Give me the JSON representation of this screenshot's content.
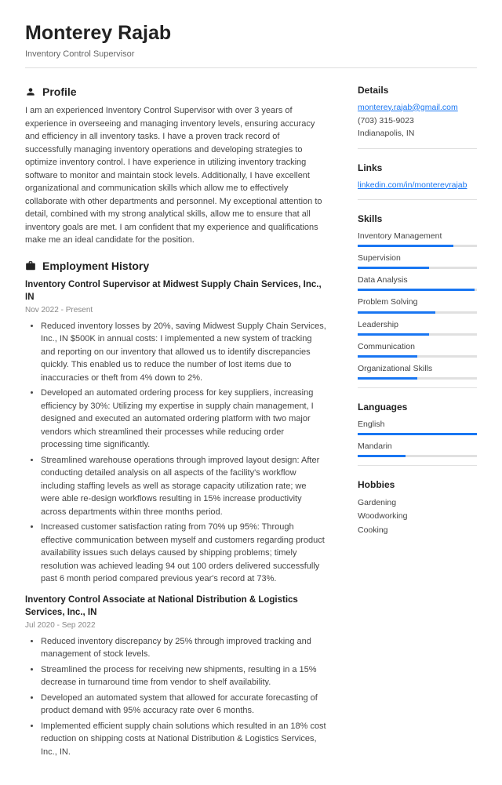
{
  "header": {
    "name": "Monterey Rajab",
    "title": "Inventory Control Supervisor"
  },
  "profile": {
    "heading": "Profile",
    "text": "I am an experienced Inventory Control Supervisor with over 3 years of experience in overseeing and managing inventory levels, ensuring accuracy and efficiency in all inventory tasks. I have a proven track record of successfully managing inventory operations and developing strategies to optimize inventory control. I have experience in utilizing inventory tracking software to monitor and maintain stock levels. Additionally, I have excellent organizational and communication skills which allow me to effectively collaborate with other departments and personnel. My exceptional attention to detail, combined with my strong analytical skills, allow me to ensure that all inventory goals are met. I am confident that my experience and qualifications make me an ideal candidate for the position."
  },
  "employment": {
    "heading": "Employment History",
    "jobs": [
      {
        "title": "Inventory Control Supervisor at Midwest Supply Chain Services, Inc., IN",
        "dates": "Nov 2022 - Present",
        "bullets": [
          "Reduced inventory losses by 20%, saving Midwest Supply Chain Services, Inc., IN $500K in annual costs: I implemented a new system of tracking and reporting on our inventory that allowed us to identify discrepancies quickly. This enabled us to reduce the number of lost items due to inaccuracies or theft from 4% down to 2%.",
          "Developed an automated ordering process for key suppliers, increasing efficiency by 30%: Utilizing my expertise in supply chain management, I designed and executed an automated ordering platform with two major vendors which streamlined their processes while reducing order processing time significantly.",
          "Streamlined warehouse operations through improved layout design: After conducting detailed analysis on all aspects of the facility's workflow including staffing levels as well as storage capacity utilization rate; we were able re-design workflows resulting in 15% increase productivity across departments within three months period.",
          "Increased customer satisfaction rating from 70% up 95%: Through effective communication between myself and customers regarding product availability issues such delays caused by shipping problems; timely resolution was achieved leading 94 out 100 orders delivered successfully past 6 month period compared previous year's record at 73%."
        ]
      },
      {
        "title": "Inventory Control Associate at National Distribution & Logistics Services, Inc., IN",
        "dates": "Jul 2020 - Sep 2022",
        "bullets": [
          "Reduced inventory discrepancy by 25% through improved tracking and management of stock levels.",
          "Streamlined the process for receiving new shipments, resulting in a 15% decrease in turnaround time from vendor to shelf availability.",
          "Developed an automated system that allowed for accurate forecasting of product demand with 95% accuracy rate over 6 months.",
          "Implemented efficient supply chain solutions which resulted in an 18% cost reduction on shipping costs at National Distribution & Logistics Services, Inc., IN."
        ]
      }
    ]
  },
  "details": {
    "heading": "Details",
    "email": "monterey.rajab@gmail.com",
    "phone": "(703) 315-9023",
    "location": "Indianapolis, IN"
  },
  "links": {
    "heading": "Links",
    "items": [
      "linkedin.com/in/montereyrajab"
    ]
  },
  "skills": {
    "heading": "Skills",
    "items": [
      {
        "name": "Inventory Management",
        "level": 80
      },
      {
        "name": "Supervision",
        "level": 60
      },
      {
        "name": "Data Analysis",
        "level": 98
      },
      {
        "name": "Problem Solving",
        "level": 65
      },
      {
        "name": "Leadership",
        "level": 60
      },
      {
        "name": "Communication",
        "level": 50
      },
      {
        "name": "Organizational Skills",
        "level": 50
      }
    ]
  },
  "languages": {
    "heading": "Languages",
    "items": [
      {
        "name": "English",
        "level": 100
      },
      {
        "name": "Mandarin",
        "level": 40
      }
    ]
  },
  "hobbies": {
    "heading": "Hobbies",
    "items": [
      "Gardening",
      "Woodworking",
      "Cooking"
    ]
  }
}
